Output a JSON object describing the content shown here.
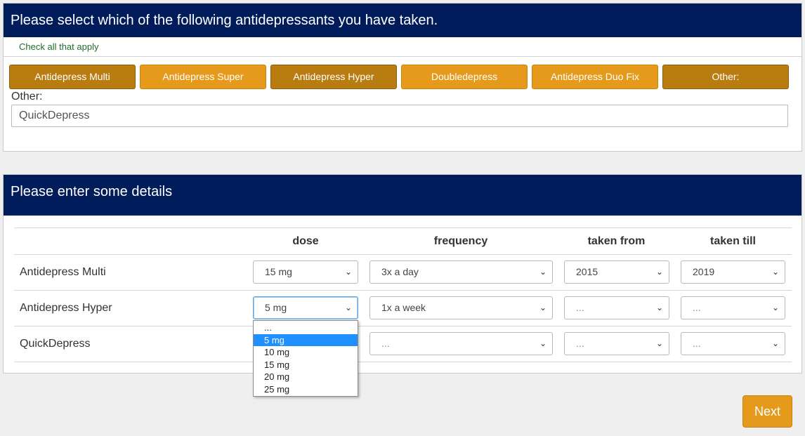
{
  "section1": {
    "title": "Please select which of the following antidepressants you have taken.",
    "subtitle": "Check all that apply",
    "options": [
      {
        "label": "Antidepress Multi",
        "selected": true
      },
      {
        "label": "Antidepress Super",
        "selected": false
      },
      {
        "label": "Antidepress Hyper",
        "selected": true
      },
      {
        "label": "Doubledepress",
        "selected": false
      },
      {
        "label": "Antidepress Duo Fix",
        "selected": false
      },
      {
        "label": "Other:",
        "selected": true
      }
    ],
    "other_label": "Other:",
    "other_value": "QuickDepress"
  },
  "section2": {
    "title": "Please enter some details",
    "columns": [
      "dose",
      "frequency",
      "taken from",
      "taken till"
    ],
    "rows": [
      {
        "name": "Antidepress Multi",
        "dose": "15 mg",
        "frequency": "3x a day",
        "from": "2015",
        "till": "2019"
      },
      {
        "name": "Antidepress Hyper",
        "dose": "5 mg",
        "frequency": "1x a week",
        "from": "...",
        "till": "..."
      },
      {
        "name": "QuickDepress",
        "dose": "",
        "frequency": "...",
        "from": "...",
        "till": "..."
      }
    ],
    "dose_dropdown_options": [
      "...",
      "5 mg",
      "10 mg",
      "15 mg",
      "20 mg",
      "25 mg"
    ],
    "dose_dropdown_highlighted": "5 mg"
  },
  "next_label": "Next",
  "colors": {
    "header_bg": "#001c5a",
    "option_selected": "#b97c10",
    "option_unselected": "#e69a1b",
    "dropdown_highlight": "#1e90ff",
    "subtitle_text": "#236c2c"
  },
  "icons": {
    "select_arrow": "chevron-down-icon"
  }
}
